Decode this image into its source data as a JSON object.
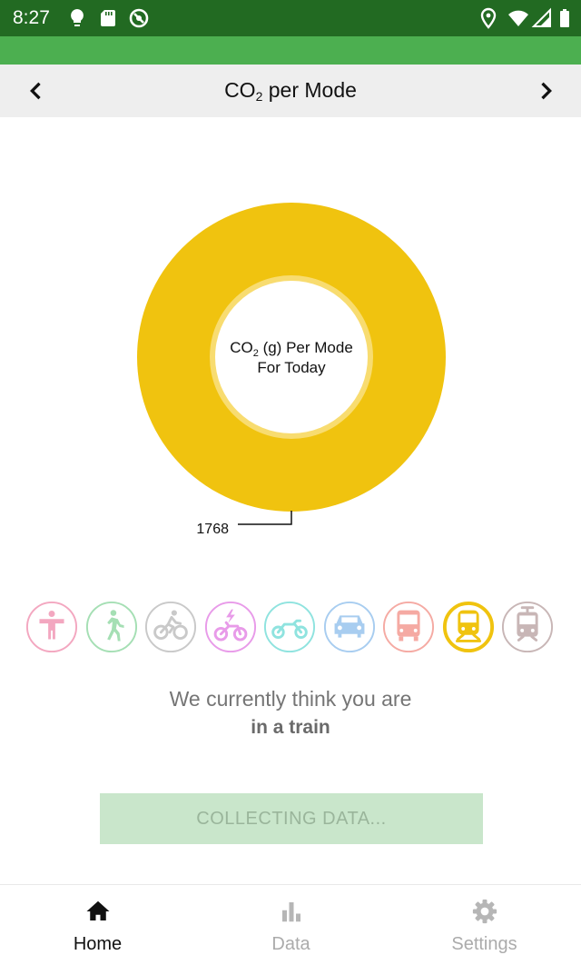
{
  "status_bar": {
    "time": "8:27"
  },
  "nav": {
    "title_prefix": "CO",
    "title_sub": "2",
    "title_suffix": " per Mode"
  },
  "chart_data": {
    "type": "pie",
    "center_label_line1_prefix": "CO",
    "center_label_line1_sub": "2",
    "center_label_line1_suffix": " (g) Per Mode",
    "center_label_line2": "For Today",
    "slices": [
      {
        "label": "train",
        "value": 1768,
        "color": "#f0c30f"
      }
    ]
  },
  "modes": [
    {
      "name": "stationary",
      "color": "#f3a7c0",
      "active": false
    },
    {
      "name": "walking",
      "color": "#a5dfb4",
      "active": false
    },
    {
      "name": "cycling",
      "color": "#c9c9c9",
      "active": false
    },
    {
      "name": "e-bike",
      "color": "#e89be9",
      "active": false
    },
    {
      "name": "motorcycle",
      "color": "#8fe3df",
      "active": false
    },
    {
      "name": "car",
      "color": "#a8cdf0",
      "active": false
    },
    {
      "name": "bus",
      "color": "#f5aaa3",
      "active": false
    },
    {
      "name": "train",
      "color": "#f0c30f",
      "active": true
    },
    {
      "name": "tram",
      "color": "#c8b6b6",
      "active": false
    }
  ],
  "status": {
    "line1": "We currently think you are",
    "line2": "in a train"
  },
  "button": {
    "label": "COLLECTING DATA..."
  },
  "tabs": [
    {
      "label": "Home",
      "icon": "home-icon",
      "active": true
    },
    {
      "label": "Data",
      "icon": "bar-chart-icon",
      "active": false
    },
    {
      "label": "Settings",
      "icon": "gear-icon",
      "active": false
    }
  ]
}
